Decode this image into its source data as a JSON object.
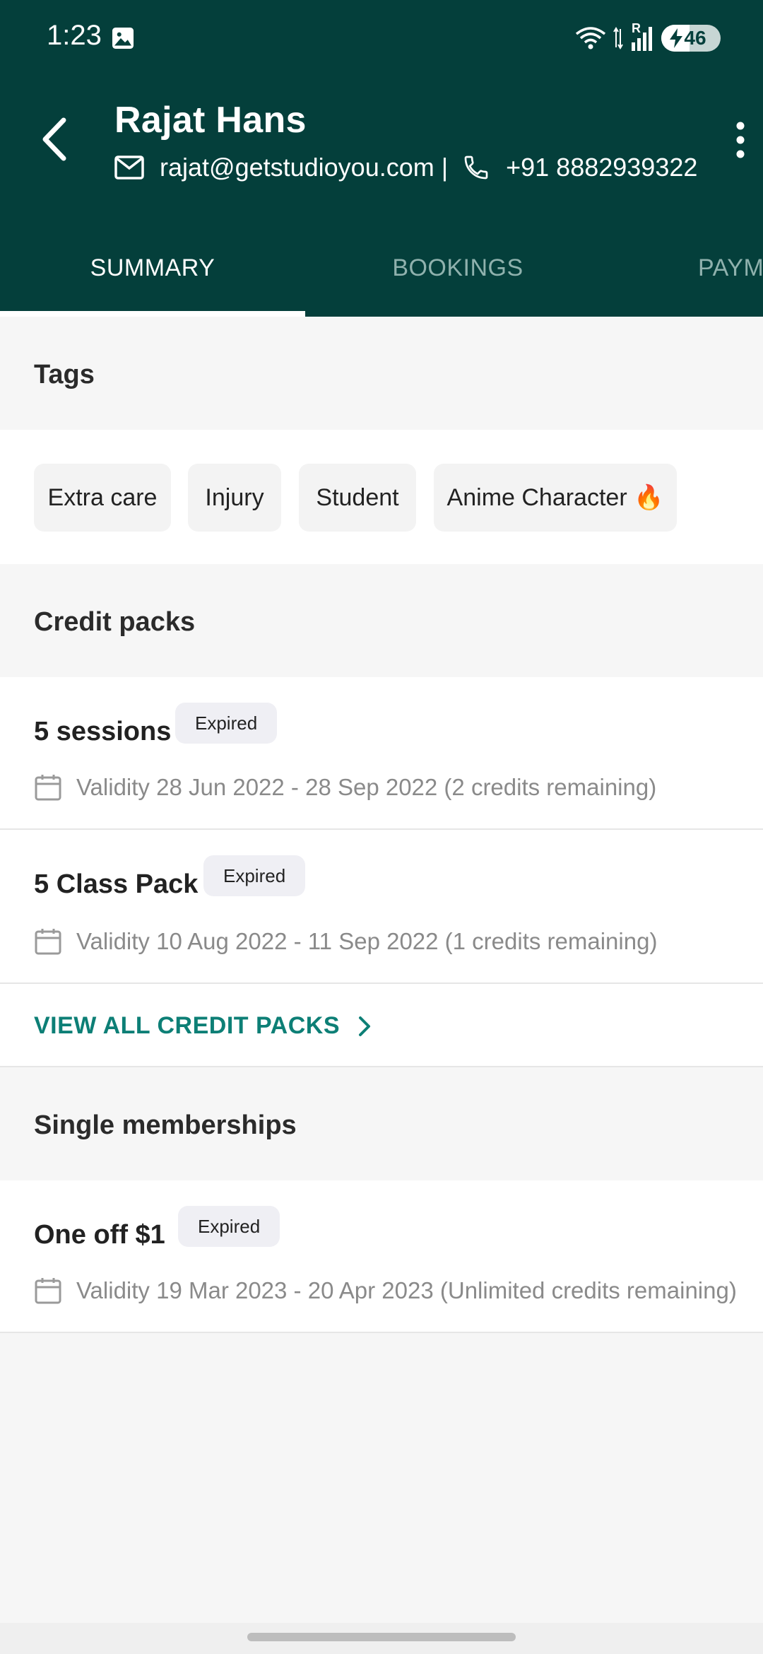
{
  "status_bar": {
    "time": "1:23",
    "battery": "46",
    "network_label": "R"
  },
  "header": {
    "name": "Rajat Hans",
    "email": "rajat@getstudioyou.com",
    "separator": "|",
    "phone": "+91 8882939322"
  },
  "tabs": [
    {
      "label": "SUMMARY"
    },
    {
      "label": "BOOKINGS"
    },
    {
      "label": "PAYM"
    }
  ],
  "tags_section": {
    "title": "Tags",
    "tags": [
      "Extra care",
      "Injury",
      "Student",
      "Anime Character 🔥"
    ]
  },
  "credit_packs": {
    "title": "Credit packs",
    "items": [
      {
        "name": "5 sessions",
        "badge": "Expired",
        "validity": "Validity 28 Jun 2022 - 28 Sep 2022 (2 credits remaining)"
      },
      {
        "name": "5 Class Pack",
        "badge": "Expired",
        "validity": "Validity 10 Aug 2022 - 11 Sep 2022 (1 credits remaining)"
      }
    ],
    "view_all": "VIEW ALL CREDIT PACKS"
  },
  "memberships": {
    "title": "Single memberships",
    "items": [
      {
        "name": "One off $1",
        "badge": "Expired",
        "validity": "Validity 19 Mar 2023 - 20 Apr 2023 (Unlimited credits remaining)"
      }
    ]
  },
  "colors": {
    "header_bg": "#043f3b",
    "accent": "#0d7f76",
    "page_bg": "#f6f6f6"
  }
}
